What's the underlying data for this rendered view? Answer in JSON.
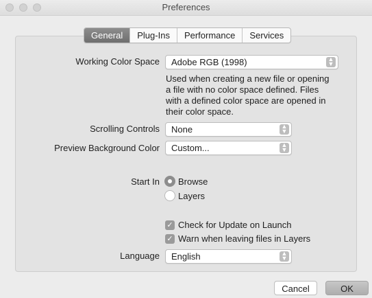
{
  "window": {
    "title": "Preferences"
  },
  "tabs": [
    {
      "label": "General",
      "active": true
    },
    {
      "label": "Plug-Ins",
      "active": false
    },
    {
      "label": "Performance",
      "active": false
    },
    {
      "label": "Services",
      "active": false
    }
  ],
  "working_color_space": {
    "label": "Working Color Space",
    "value": "Adobe RGB (1998)",
    "help": "Used when creating a new file or opening a file with no color space defined. Files with a defined color space are opened in their color space."
  },
  "scrolling_controls": {
    "label": "Scrolling Controls",
    "value": "None"
  },
  "preview_background_color": {
    "label": "Preview Background Color",
    "value": "Custom..."
  },
  "start_in": {
    "label": "Start In",
    "options": [
      {
        "label": "Browse",
        "selected": true
      },
      {
        "label": "Layers",
        "selected": false
      }
    ]
  },
  "checkboxes": [
    {
      "label": "Check for Update on Launch",
      "checked": true
    },
    {
      "label": "Warn when leaving files in Layers",
      "checked": true
    }
  ],
  "language": {
    "label": "Language",
    "value": "English"
  },
  "buttons": {
    "cancel": "Cancel",
    "ok": "OK"
  },
  "icons": {
    "stepper": "up-down-chevron-icon",
    "check": "checkmark-icon"
  }
}
